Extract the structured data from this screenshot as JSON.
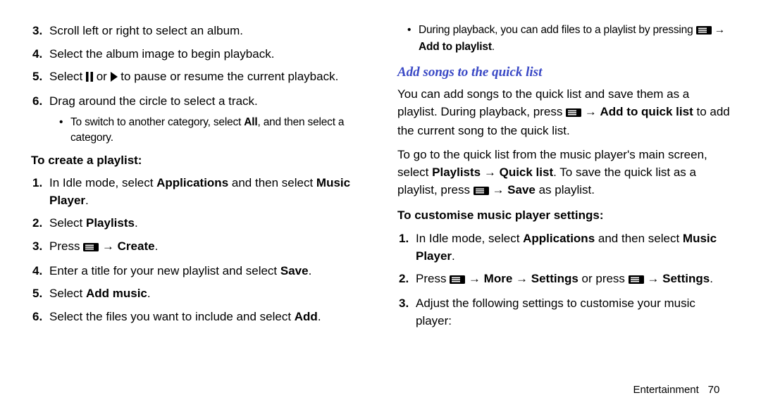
{
  "left": {
    "s3": "Scroll left or right to select an album.",
    "s4": "Select the album image to begin playback.",
    "s5a": "Select ",
    "s5_or": " or ",
    "s5b": " to pause or resume the current playback.",
    "s6": "Drag around the circle to select a track.",
    "s6_sub_a": "To switch to another category, select ",
    "s6_sub_all": "All",
    "s6_sub_b": ", and then select a category.",
    "createHead": "To create a playlist:",
    "c1a": "In Idle mode, select ",
    "c1_apps": "Applications",
    "c1b": " and then select ",
    "c1_mp": "Music Player",
    "dot": ".",
    "c2a": "Select ",
    "c2_pl": "Playlists",
    "c3a": "Press ",
    "arrow": " → ",
    "c3_create": "Create",
    "c4a": "Enter a title for your new playlist and select ",
    "c4_save": "Save",
    "c5a": "Select ",
    "c5_add": "Add music",
    "c6a": "Select the files you want to include and select ",
    "c6_add": "Add"
  },
  "right": {
    "top_sub_a": "During playback, you can add files to a playlist by pressing ",
    "top_sub_b": " ",
    "arrow": " → ",
    "top_sub_add": "Add to playlist",
    "dot": ".",
    "heading": "Add songs to the quick list",
    "p1a": "You can add songs to the quick list and save them as a playlist. During playback, press ",
    "p1_q": "Add to quick list",
    "p1b": " to add the current song to the quick list.",
    "p2a": "To go to the quick list from the music player's main screen, select ",
    "p2_pl": "Playlists",
    "p2_ql": "Quick list",
    "p2b": ". To save the quick list as a playlist, press ",
    "p2_save": "Save",
    "p2c": " as playlist.",
    "custHead": "To customise music player settings:",
    "cu1a": "In Idle mode, select ",
    "cu1_apps": "Applications",
    "cu1b": " and then select ",
    "cu1_mp": "Music Player",
    "cu2a": "Press ",
    "cu2_more": "More",
    "cu2_set": "Settings",
    "cu2_or": " or press ",
    "cu3": "Adjust the following settings to customise your music player:"
  },
  "footer": {
    "section": "Entertainment",
    "page": "70"
  }
}
